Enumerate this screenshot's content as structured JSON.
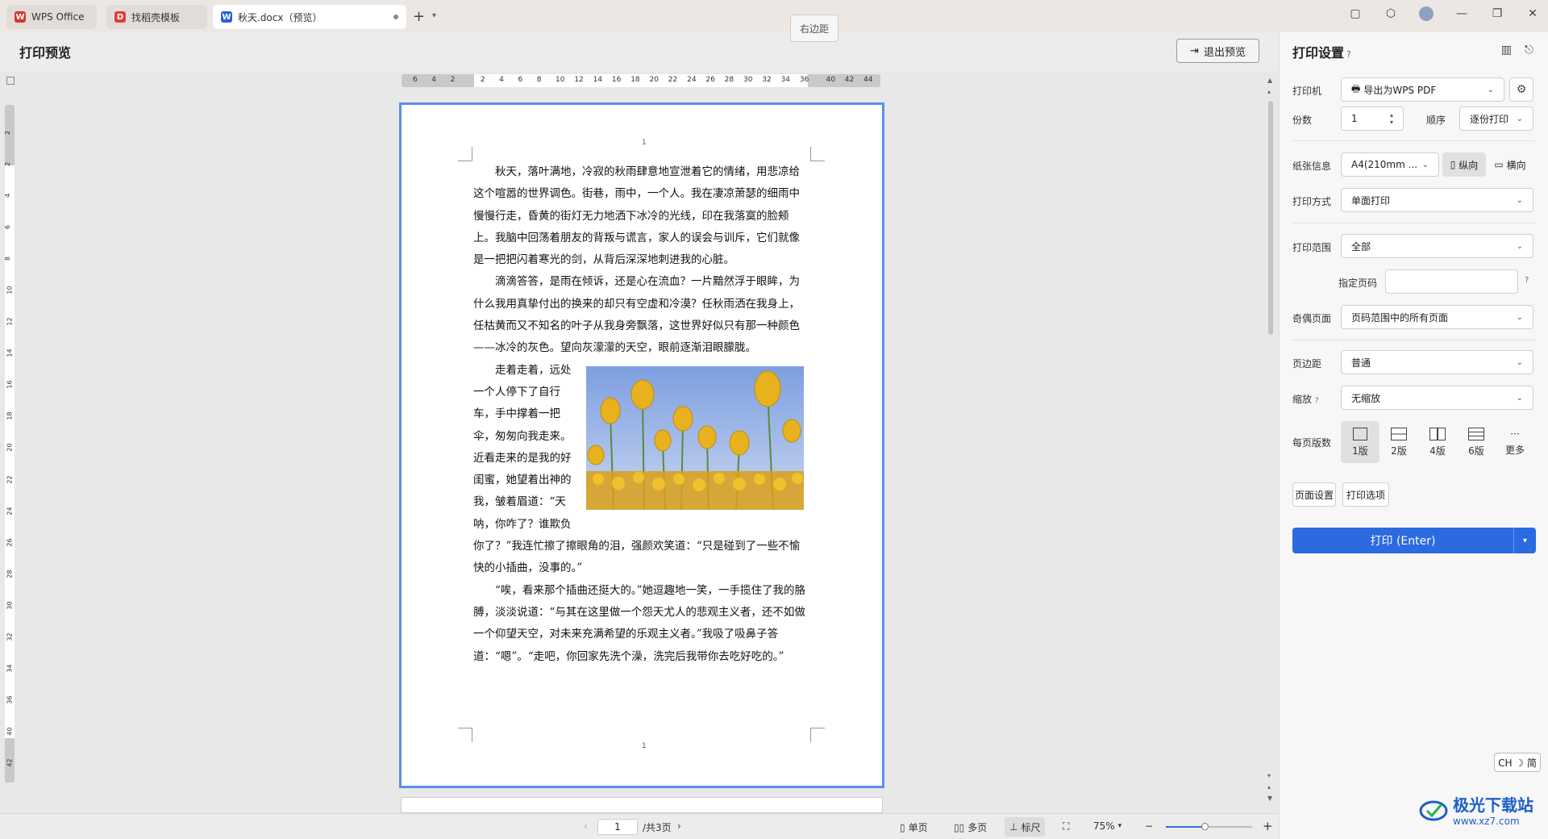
{
  "titlebar": {
    "tabs": [
      {
        "label": "WPS Office",
        "color": "#d9352b"
      },
      {
        "label": "找稻壳模板",
        "color": "#e0403a"
      },
      {
        "label": "秋天.docx（预览）",
        "color": "#2b62d9"
      }
    ],
    "tooltip": "右边距"
  },
  "preview": {
    "title": "打印预览",
    "exit_label": "退出预览"
  },
  "ruler": {
    "h_ticks": [
      "6",
      "4",
      "2",
      "2",
      "4",
      "6",
      "8",
      "10",
      "12",
      "14",
      "16",
      "18",
      "20",
      "22",
      "24",
      "26",
      "28",
      "30",
      "32",
      "34",
      "36",
      "40",
      "42",
      "44"
    ],
    "v_ticks": [
      "2",
      "2",
      "4",
      "6",
      "8",
      "10",
      "12",
      "14",
      "16",
      "18",
      "20",
      "22",
      "24",
      "26",
      "28",
      "30",
      "32",
      "34",
      "36",
      "40",
      "42"
    ]
  },
  "document": {
    "page_number_top": "1",
    "page_number_bottom": "1",
    "paragraphs": [
      "秋天，落叶满地，冷寂的秋雨肆意地宣泄着它的情绪，用悲凉给这个喧嚣的世界调色。街巷，雨中，一个人。我在凄凉萧瑟的细雨中慢慢行走，昏黄的街灯无力地洒下冰冷的光线，印在我落寞的脸颊上。我脑中回荡着朋友的背叛与谎言，家人的误会与训斥，它们就像是一把把闪着寒光的剑，从背后深深地刺进我的心脏。",
      "滴滴答答，是雨在倾诉，还是心在流血？一片黯然浮于眼眸，为什么我用真挚付出的换来的却只有空虚和冷漠？任秋雨洒在我身上，任枯黄而又不知名的叶子从我身旁飘落，这世界好似只有那一种颜色——冰冷的灰色。望向灰濛濛的天空，眼前逐渐泪眼朦胧。",
      "走着走着，远处一个人停下了自行车，手中撑着一把伞，匆匆向我走来。近看走来的是我的好闺蜜，她望着出神的我，皱着眉道：“天呐，你咋了？谁欺负你了？”我连忙擦了擦眼角的泪，强颜欢笑道：“只是碰到了一些不愉快的小插曲，没事的。”",
      "“唉，看来那个插曲还挺大的。”她逗趣地一笑，一手揽住了我的胳膊，淡淡说道：“与其在这里做一个怨天尤人的悲观主义者，还不如做一个仰望天空，对未来充满希望的乐观主义者。”我吸了吸鼻子答道：“嗯”。“走吧，你回家先洗个澡，洗完后我带你去吃好吃的。”"
    ]
  },
  "bottombar": {
    "page_value": "1",
    "total_pages": "/共3页",
    "single_page": "单页",
    "multi_page": "多页",
    "ruler": "标尺",
    "zoom": "75%",
    "zoom_fraction": 0.45
  },
  "panel": {
    "title": "打印设置",
    "printer_label": "打印机",
    "printer_value": "导出为WPS PDF",
    "copies_label": "份数",
    "copies_value": "1",
    "order_label": "顺序",
    "order_value": "逐份打印",
    "paper_label": "纸张信息",
    "paper_value": "A4(210mm ...",
    "portrait": "纵向",
    "landscape": "横向",
    "mode_label": "打印方式",
    "mode_value": "单面打印",
    "range_label": "打印范围",
    "range_value": "全部",
    "pages_label": "指定页码",
    "pages_value": "",
    "oddeven_label": "奇偶页面",
    "oddeven_value": "页码范围中的所有页面",
    "margin_label": "页边距",
    "margin_value": "普通",
    "scale_label": "缩放",
    "scale_value": "无缩放",
    "perpage_label": "每页版数",
    "layouts": [
      "1版",
      "2版",
      "4版",
      "6版",
      "更多"
    ],
    "page_setup": "页面设置",
    "print_options": "打印选项",
    "print_button": "打印 (Enter)"
  },
  "ime": "CH ☽ 简",
  "watermark": {
    "title": "极光下载站",
    "url": "www.xz7.com"
  }
}
